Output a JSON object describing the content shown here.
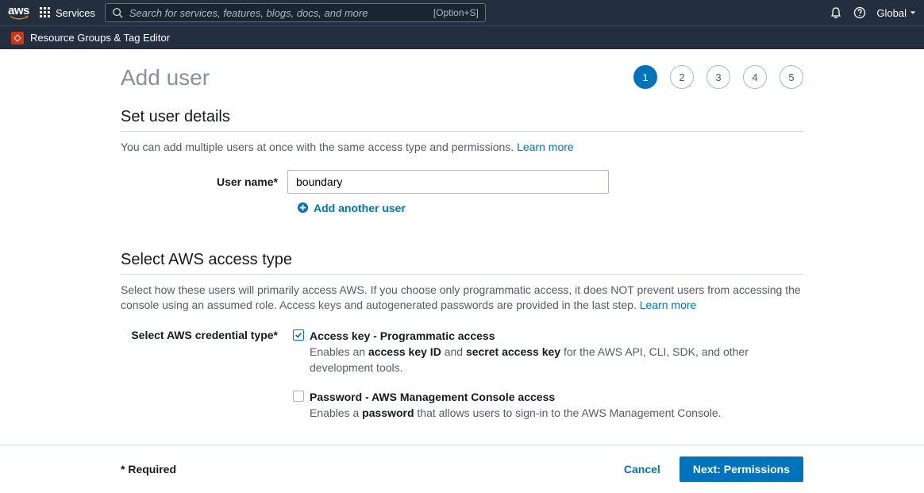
{
  "nav": {
    "services_label": "Services",
    "search_placeholder": "Search for services, features, blogs, docs, and more",
    "search_shortcut": "[Option+S]",
    "region": "Global"
  },
  "secondbar": {
    "resource_groups": "Resource Groups & Tag Editor"
  },
  "page": {
    "title": "Add user",
    "steps": [
      "1",
      "2",
      "3",
      "4",
      "5"
    ],
    "active_step": 0
  },
  "section1": {
    "title": "Set user details",
    "helper": "You can add multiple users at once with the same access type and permissions.",
    "learn_more": "Learn more",
    "username_label": "User name*",
    "username_value": "boundary",
    "add_another": "Add another user"
  },
  "section2": {
    "title": "Select AWS access type",
    "helper": "Select how these users will primarily access AWS. If you choose only programmatic access, it does NOT prevent users from accessing the console using an assumed role. Access keys and autogenerated passwords are provided in the last step.",
    "learn_more": "Learn more",
    "credential_label": "Select AWS credential type*",
    "options": [
      {
        "checked": true,
        "title": "Access key - Programmatic access",
        "desc_prefix": "Enables an ",
        "bold1": "access key ID",
        "mid": " and ",
        "bold2": "secret access key",
        "desc_suffix": " for the AWS API, CLI, SDK, and other development tools."
      },
      {
        "checked": false,
        "title": "Password - AWS Management Console access",
        "desc_prefix": "Enables a ",
        "bold1": "password",
        "mid": "",
        "bold2": "",
        "desc_suffix": " that allows users to sign-in to the AWS Management Console."
      }
    ]
  },
  "footer": {
    "required": "* Required",
    "cancel": "Cancel",
    "next": "Next: Permissions"
  }
}
